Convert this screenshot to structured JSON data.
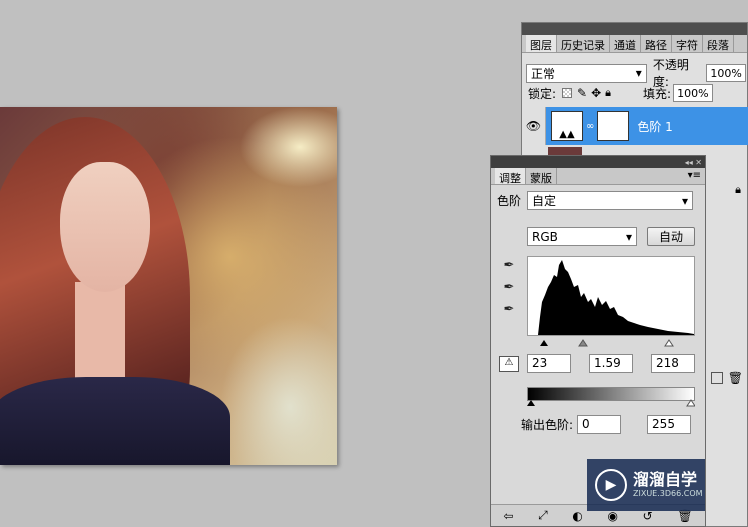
{
  "layers_panel": {
    "tabs": [
      "图层",
      "历史记录",
      "通道",
      "路径",
      "字符",
      "段落"
    ],
    "blend_mode": "正常",
    "opacity_label": "不透明度:",
    "opacity_value": "100%",
    "lock_label": "锁定:",
    "fill_label": "填充:",
    "fill_value": "100%",
    "layer_name": "色阶 1"
  },
  "adjust_panel": {
    "tabs": [
      "调整",
      "蒙版"
    ],
    "adjustment_label": "色阶",
    "preset_value": "自定",
    "channel_value": "RGB",
    "auto_button": "自动",
    "input_black": "23",
    "input_gamma": "1.59",
    "input_white": "218",
    "output_label": "输出色阶:",
    "output_black": "0",
    "output_white": "255"
  },
  "icons": [
    "eye-icon",
    "dropdown-arrow-icon",
    "lock-transparent-icon",
    "brush-icon",
    "move-icon",
    "lock-icon",
    "levels-icon",
    "chain-icon",
    "eyedropper-black-icon",
    "eyedropper-gray-icon",
    "eyedropper-white-icon",
    "warning-icon",
    "back-arrow-icon",
    "expand-icon",
    "mask-icon",
    "visibility-icon",
    "reset-icon",
    "trash-icon"
  ],
  "watermark": {
    "title": "溜溜自学",
    "url": "ZIXUE.3D66.COM"
  }
}
